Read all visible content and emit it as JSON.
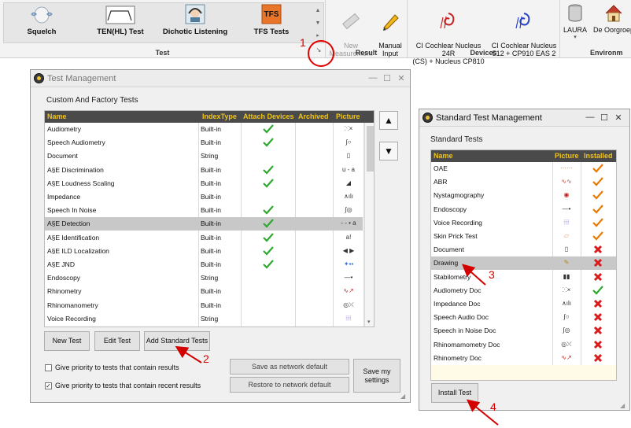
{
  "ribbon": {
    "test_group": {
      "label": "Test",
      "items": [
        {
          "label": "Squelch",
          "icon": "squelch-icon"
        },
        {
          "label": "TEN(HL) Test",
          "icon": "ten-hl-icon"
        },
        {
          "label": "Dichotic Listening",
          "icon": "dichotic-icon"
        },
        {
          "label": "TFS Tests",
          "icon": "tfs-icon"
        }
      ]
    },
    "result_group": {
      "label": "Result",
      "new_measurement": "New\nMeasurement",
      "manual_input": "Manual\nInput"
    },
    "devices_group": {
      "label": "Devices",
      "items": [
        "CI Cochlear Nucleus 24R\n(CS) + Nucleus CP810",
        "CI Cochlear Nucleus\n512 + CP910 EAS 2"
      ]
    },
    "environment_group": {
      "label": "Environm",
      "items": [
        "LAURA",
        "De Oorgroep"
      ]
    }
  },
  "annotations": [
    "1",
    "2",
    "3",
    "4"
  ],
  "test_management": {
    "title": "Test Management",
    "section": "Custom And Factory Tests",
    "columns": [
      "Name",
      "IndexType",
      "Attach Devices",
      "Archived",
      "Picture"
    ],
    "rows": [
      {
        "name": "Audiometry",
        "type": "Built-in",
        "attach": true,
        "pic": "audiometry-icon"
      },
      {
        "name": "Speech Audiometry",
        "type": "Built-in",
        "attach": true,
        "pic": "speech-icon"
      },
      {
        "name": "Document",
        "type": "String",
        "attach": false,
        "pic": "document-icon"
      },
      {
        "name": "A§E Discrimination",
        "type": "Built-in",
        "attach": true,
        "pic": "u - a"
      },
      {
        "name": "A§E Loudness Scaling",
        "type": "Built-in",
        "attach": true,
        "pic": "loudness-icon"
      },
      {
        "name": "Impedance",
        "type": "Built-in",
        "attach": false,
        "pic": "impedance-icon"
      },
      {
        "name": "Speech In Noise",
        "type": "Built-in",
        "attach": true,
        "pic": "speech-noise-icon"
      },
      {
        "name": "A§E Detection",
        "type": "Built-in",
        "attach": true,
        "pic": "- - • a",
        "selected": true
      },
      {
        "name": "A§E Identification",
        "type": "Built-in",
        "attach": true,
        "pic": "a!"
      },
      {
        "name": "A§E ILD Localization",
        "type": "Built-in",
        "attach": true,
        "pic": "◀ ▶"
      },
      {
        "name": "A§E JND",
        "type": "Built-in",
        "attach": true,
        "pic": "jnd-icon"
      },
      {
        "name": "Endoscopy",
        "type": "String",
        "attach": false,
        "pic": "endoscope-icon"
      },
      {
        "name": "Rhinometry",
        "type": "Built-in",
        "attach": false,
        "pic": "rhinometry-icon"
      },
      {
        "name": "Rhinomanometry",
        "type": "Built-in",
        "attach": false,
        "pic": "rhinomanometry-icon"
      },
      {
        "name": "Voice Recording",
        "type": "String",
        "attach": false,
        "pic": "voice-icon"
      }
    ],
    "buttons": {
      "new_test": "New Test",
      "edit_test": "Edit Test",
      "add_standard": "Add Standard Tests",
      "save_network": "Save as network default",
      "restore_network": "Restore to network default",
      "save_settings": "Save my\nsettings"
    },
    "checkboxes": [
      {
        "label": "Give priority to tests that contain results",
        "checked": false
      },
      {
        "label": "Give priority to tests that contain recent results",
        "checked": true
      }
    ]
  },
  "standard_test_management": {
    "title": "Standard Test Management",
    "section": "Standard Tests",
    "columns": [
      "Name",
      "Picture",
      "Installed"
    ],
    "rows": [
      {
        "name": "OAE",
        "installed": true,
        "pic": "oae-icon"
      },
      {
        "name": "ABR",
        "installed": true,
        "pic": "abr-icon"
      },
      {
        "name": "Nystagmography",
        "installed": true,
        "pic": "nystag-icon"
      },
      {
        "name": "Endoscopy",
        "installed": true,
        "pic": "endoscope-icon"
      },
      {
        "name": "Voice Recording",
        "installed": true,
        "pic": "voice-icon"
      },
      {
        "name": "Skin Prick Test",
        "installed": true,
        "pic": "skin-icon"
      },
      {
        "name": "Document",
        "installed": false,
        "pic": "document-icon"
      },
      {
        "name": "Drawing",
        "installed": false,
        "pic": "drawing-icon",
        "selected": true
      },
      {
        "name": "Stabilometry",
        "installed": false,
        "pic": "feet-icon"
      },
      {
        "name": "Audiometry Doc",
        "installed": true,
        "pic": "audiometry-icon"
      },
      {
        "name": "Impedance Doc",
        "installed": false,
        "pic": "impedance-icon"
      },
      {
        "name": "Speech Audio Doc",
        "installed": false,
        "pic": "speech-icon"
      },
      {
        "name": "Speech in Noise Doc",
        "installed": false,
        "pic": "speech-noise-icon"
      },
      {
        "name": "Rhinomamometry Doc",
        "installed": false,
        "pic": "rhinomanometry-icon"
      },
      {
        "name": "Rhinometry Doc",
        "installed": false,
        "pic": "rhinometry-icon"
      }
    ],
    "install_button": "Install Test"
  },
  "colors": {
    "header_bg": "#4a4a4a",
    "header_text": "#f0c419",
    "check_green": "#2fa82f",
    "check_orange": "#e87a00",
    "x_red": "#d81c1c",
    "annotation_red": "#d40000"
  }
}
